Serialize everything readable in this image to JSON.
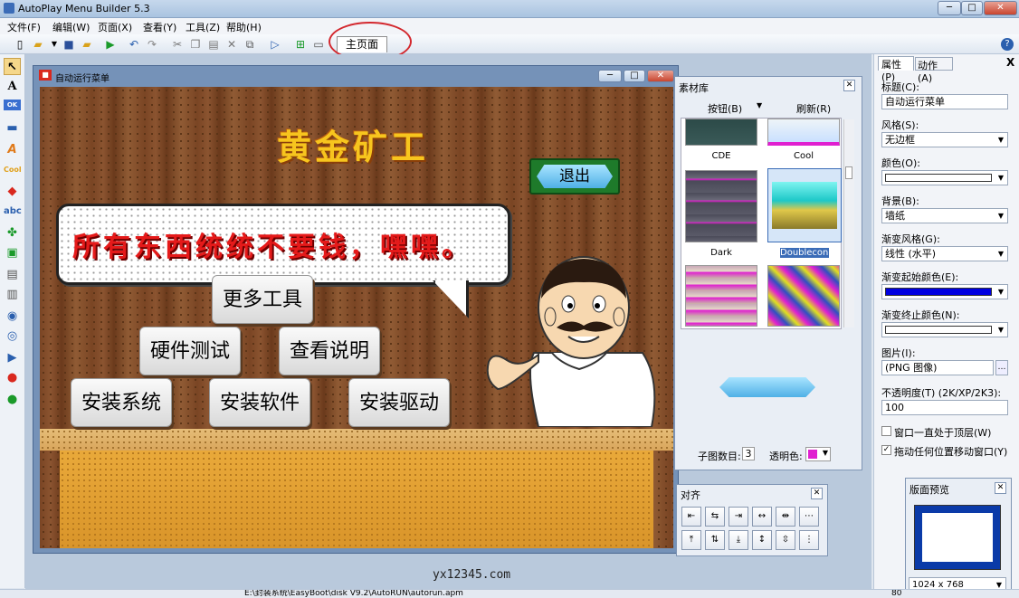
{
  "app": {
    "title": "AutoPlay Menu Builder 5.3"
  },
  "menu": [
    "文件(F)",
    "编辑(W)",
    "页面(X)",
    "查看(Y)",
    "工具(Z)",
    "帮助(H)"
  ],
  "page_tab": "主页面",
  "child_window": {
    "title": "自动运行菜单"
  },
  "game": {
    "title": "黄金矿工",
    "exit": "退出",
    "bubble": "所有东西统统不要钱，嘿嘿。",
    "buttons": [
      "更多工具",
      "硬件测试",
      "查看说明",
      "安装系统",
      "安装软件",
      "安装驱动"
    ]
  },
  "materials": {
    "title": "素材库",
    "btn_label": "按钮(B)",
    "refresh": "刷新(R)",
    "items": [
      "CDE",
      "Cool",
      "Dark",
      "Doublecone"
    ],
    "subcount_label": "子图数目:",
    "subcount": "3",
    "transparent_label": "透明色:"
  },
  "align": {
    "title": "对齐"
  },
  "props": {
    "tab1": "属性(P)",
    "tab2": "动作(A)",
    "close": "X",
    "title_label": "标题(C):",
    "title_value": "自动运行菜单",
    "style_label": "风格(S):",
    "style_value": "无边框",
    "color_label": "颜色(O):",
    "bg_label": "背景(B):",
    "bg_value": "墙纸",
    "grad_style_label": "渐变风格(G):",
    "grad_style_value": "线性 (水平)",
    "grad_start_label": "渐变起始颜色(E):",
    "grad_end_label": "渐变终止颜色(N):",
    "image_label": "图片(I):",
    "image_value": "(PNG 图像)",
    "opacity_label": "不透明度(T) (2K/XP/2K3):",
    "opacity_value": "100",
    "chk1": "窗口一直处于顶层(W)",
    "chk2": "拖动任何位置移动窗口(Y)",
    "preview_title": "版面预览",
    "preview_size": "1024 x 768",
    "grad_start_color": "#0000e0",
    "grad_end_color": "#ffffff"
  },
  "watermark": "yx12345.com",
  "status": "E:\\封装系统\\EasyBoot\\disk V9.2\\AutoRUN\\autorun.apm",
  "status_right": "80"
}
